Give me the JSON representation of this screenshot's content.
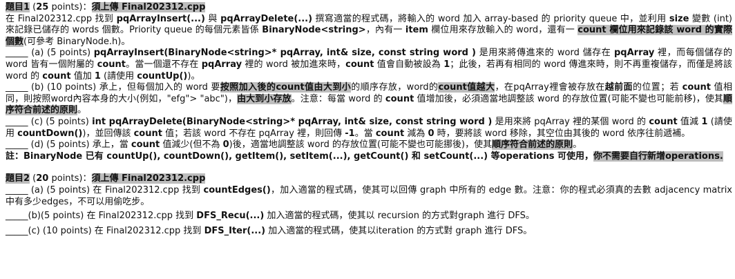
{
  "q1": {
    "heading": "題目1",
    "points_pre": " (",
    "points_num": "25",
    "points_post": " points)：",
    "upload": "須上傳 Final202312.cpp",
    "intro_1": "在 Final202312.cpp 找到 ",
    "fn_insert": "pqArrayInsert(...)",
    "intro_2": " 與 ",
    "fn_delete": "pqArrayDelete(...)",
    "intro_3": " 撰寫適當的程式碼，將輸入的 word 加入 array-based 的 priority queue 中，並利用 ",
    "size_kw": "size",
    "intro_4": " 變數 (int) 來記錄已儲存的 words 個數。Priority queue 的每個元素皆係 ",
    "node_type": "BinaryNode<string>",
    "intro_5": "，內有一 ",
    "item_kw": "item",
    "intro_6": " 欄位用來存放輸入的 word，還有一 ",
    "count_hl": "count 欄位用來記錄該 word 的實際個數",
    "intro_7": "(可參考 BinaryNode.h)。",
    "a_blank": "_____ (a) (5 points) ",
    "a_sig": "pqArrayInsert(BinaryNode<string>* pqArray, int& size, const string word )",
    "a_1": " 是用來將傳進來的 word 儲存在 ",
    "a_pq": "pqArray",
    "a_2": " 裡，而每個儲存的 word 皆有一個附屬的 ",
    "a_count1": "count",
    "a_3": "。當一個還不存在 ",
    "a_pq2": "pqArray",
    "a_4": " 裡的 word 被加進來時，",
    "a_count2": "count",
    "a_5": " 值會自動被設為 ",
    "a_one": "1",
    "a_6": "；此後，若再有相同的 word 傳進來時，則不再重複儲存，而僅是將該word 的 ",
    "a_count3": "count",
    "a_7": " 值加 ",
    "a_one2": "1",
    "a_8": " (請使用 ",
    "a_up": "countUp()",
    "a_9": ")。",
    "b_blank": "_____ (b) (10 points) 承上，但每個加入的 word 要",
    "b_hl1": "按照加入後的count值由大到小",
    "b_1": "的順序存放，word的",
    "b_hl2": "count值越大",
    "b_2": "，在pqArray裡會被存放在",
    "b_front": "越前面",
    "b_3": "的位置；若 ",
    "b_count": "count",
    "b_4": " 值相同，則按照word內容本身的大小(例如，\"efg\"> \"abc\")，",
    "b_hl3": "由大到小存放",
    "b_5": "。注意：每當 word 的 ",
    "b_count2": "count",
    "b_6": " 值增加後，必須適當地調整該 word 的存放位置(可能不變也可能前移)，使其",
    "b_hl4": "順序符合前述的原則",
    "b_7": "。",
    "c_blank": "_____ (c) (5 points) ",
    "c_sig": "int pqArrayDelete(BinaryNode<string>* pqArray, int& size, const string word )",
    "c_1": " 是用來將 pqArray 裡的某個 word 的 ",
    "c_count": "count",
    "c_2": " 值減 ",
    "c_one": "1",
    "c_3": " (請使用 ",
    "c_down": "countDown()",
    "c_4": ")，並回傳該 ",
    "c_count2": "count",
    "c_5": " 值；若該 word 不存在 pqArray 裡，則回傳 ",
    "c_neg": "-1",
    "c_6": "。當 ",
    "c_count3": "count",
    "c_7": " 減為 ",
    "c_zero": "0",
    "c_8": " 時，要將該 word 移除，其空位由其後的 word 依序往前遞補。",
    "d_blank": "_____ (d) (5 points) 承上，當 ",
    "d_count": "count",
    "d_1": " 值減少(但不為 ",
    "d_zero": "0",
    "d_2": ")後，適當地調整該 word 的存放位置(可能不變也可能挪後)，使其",
    "d_hl": "順序符合前述的原則",
    "d_3": "。",
    "note_1": "註：BinaryNode 已有 countUp(), countDown(), getItem(), setItem(...), getCount() 和 setCount(...) 等operations 可使用，",
    "note_hl": "你不需要自行新增operations."
  },
  "q2": {
    "heading": "題目2",
    "points_pre": " (",
    "points_num": "20",
    "points_post": " points)：",
    "upload": "須上傳 Final202312.cpp",
    "a_blank": "_____ (a) (5 points) 在 Final202312.cpp 找到 ",
    "a_fn": "countEdges()",
    "a_1": "，加入適當的程式碼，使其可以回傳 graph 中所有的 edge 數。注意：你的程式必須真的去數 adjacency matrix 中有多少edges，不可以用偷吃步。",
    "b_blank": "_____(b)(5 points) 在 Final202312.cpp 找到 ",
    "b_fn": "DFS_Recu(...)",
    "b_1": " 加入適當的程式碼，使其以 recursion 的方式對graph 進行 DFS。",
    "c_blank": "_____(c) (10 points) 在 Final202312.cpp 找到 ",
    "c_fn": "DFS_Iter(...)",
    "c_1": " 加入適當的程式碼，使其以iteration 的方式對 graph 進行 DFS。"
  }
}
